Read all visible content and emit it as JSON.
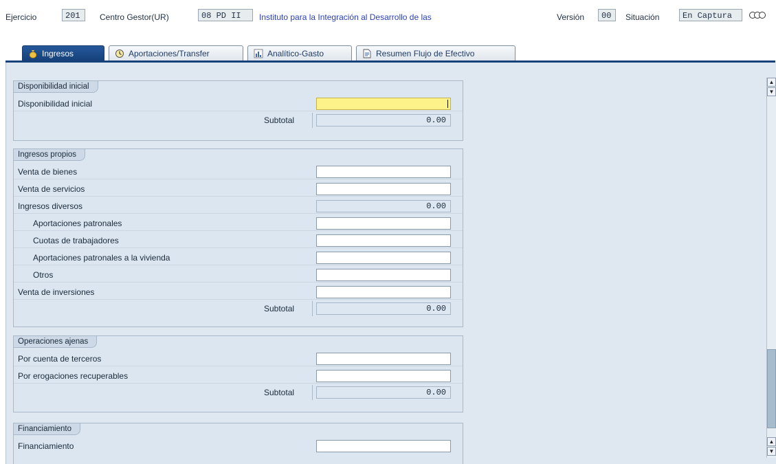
{
  "header": {
    "ejercicio_label": "Ejercicio",
    "ejercicio_value": "201",
    "centro_label": "Centro Gestor(UR)",
    "centro_value": "08 PD II",
    "centro_desc": "Instituto para la Integración al Desarrollo de las",
    "version_label": "Versión",
    "version_value": "00",
    "situacion_label": "Situación",
    "situacion_value": "En Captura"
  },
  "tabs": [
    {
      "label": "Ingresos",
      "icon": "money-bag-icon",
      "active": true
    },
    {
      "label": "Aportaciones/Transfer",
      "icon": "clock-icon",
      "active": false
    },
    {
      "label": "Analítico-Gasto",
      "icon": "chart-icon",
      "active": false
    },
    {
      "label": "Resumen Flujo de Efectivo",
      "icon": "document-icon",
      "active": false
    }
  ],
  "sections": {
    "disponibilidad": {
      "title": "Disponibilidad inicial",
      "rows": [
        {
          "label": "Disponibilidad inicial"
        }
      ],
      "subtotal_label": "Subtotal",
      "subtotal_value": "0.00"
    },
    "ingresos": {
      "title": "Ingresos propios",
      "rows": [
        {
          "label": "Venta de bienes"
        },
        {
          "label": "Venta de servicios"
        },
        {
          "label": "Ingresos diversos",
          "value": "0.00"
        },
        {
          "label": "Aportaciones patronales"
        },
        {
          "label": "Cuotas de trabajadores"
        },
        {
          "label": "Aportaciones patronales a la vivienda"
        },
        {
          "label": "Otros"
        },
        {
          "label": "Venta de inversiones"
        }
      ],
      "subtotal_label": "Subtotal",
      "subtotal_value": "0.00"
    },
    "operaciones": {
      "title": "Operaciones ajenas",
      "rows": [
        {
          "label": "Por cuenta de terceros"
        },
        {
          "label": "Por erogaciones recuperables"
        }
      ],
      "subtotal_label": "Subtotal",
      "subtotal_value": "0.00"
    },
    "financiamiento": {
      "title": "Financiamiento",
      "rows": [
        {
          "label": "Financiamiento"
        }
      ]
    }
  },
  "colors": {
    "active_tab": "#1d4f8f",
    "focus_field": "#fdf28a",
    "panel_bg": "#dfe8f0"
  }
}
